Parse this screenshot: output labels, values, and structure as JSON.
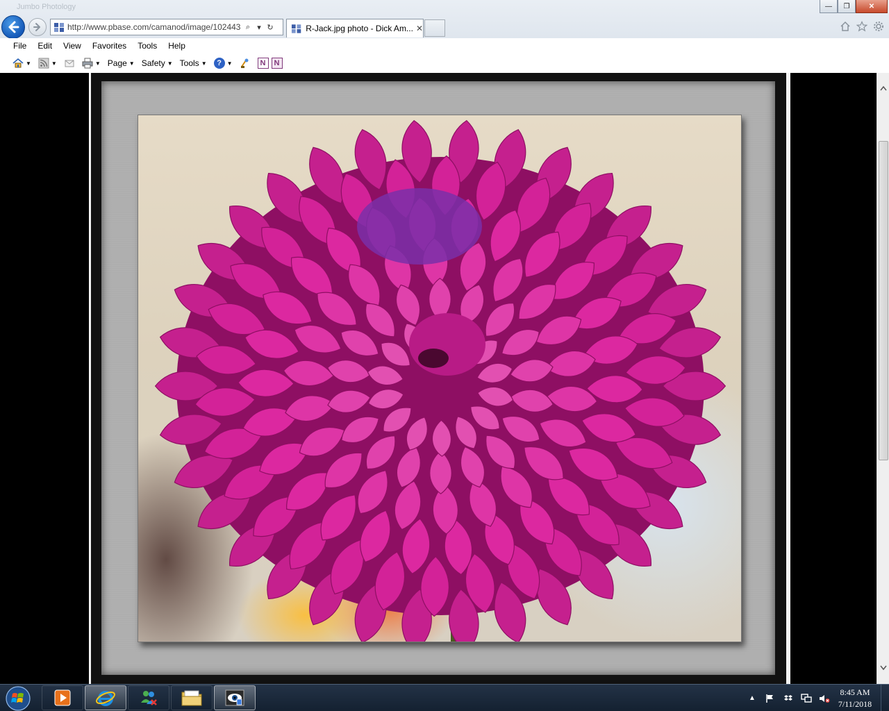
{
  "window": {
    "ghost_title": "Jumbo Photology",
    "controls": {
      "minimize": "—",
      "maximize": "❐",
      "close": "✕"
    }
  },
  "address": {
    "url": "http://www.pbase.com/camanod/image/102443",
    "search_glyph": "⌕",
    "dropdown_glyph": "▾",
    "refresh_glyph": "↻"
  },
  "tabs": [
    {
      "title": "R-Jack.jpg photo - Dick Am...",
      "close": "✕"
    }
  ],
  "menu": [
    "File",
    "Edit",
    "View",
    "Favorites",
    "Tools",
    "Help"
  ],
  "command_bar": {
    "page": "Page",
    "safety": "Safety",
    "tools": "Tools",
    "help_glyph": "?",
    "onenote": "N",
    "onenote_send": "N"
  },
  "taskbar": {
    "clock_time": "8:45 AM",
    "clock_date": "7/11/2018",
    "tray_up": "▲"
  },
  "colors": {
    "petal": "#b81b86",
    "petal_dark": "#8e0f63",
    "center": "#7a2fa8",
    "stem": "#4a5a22"
  }
}
